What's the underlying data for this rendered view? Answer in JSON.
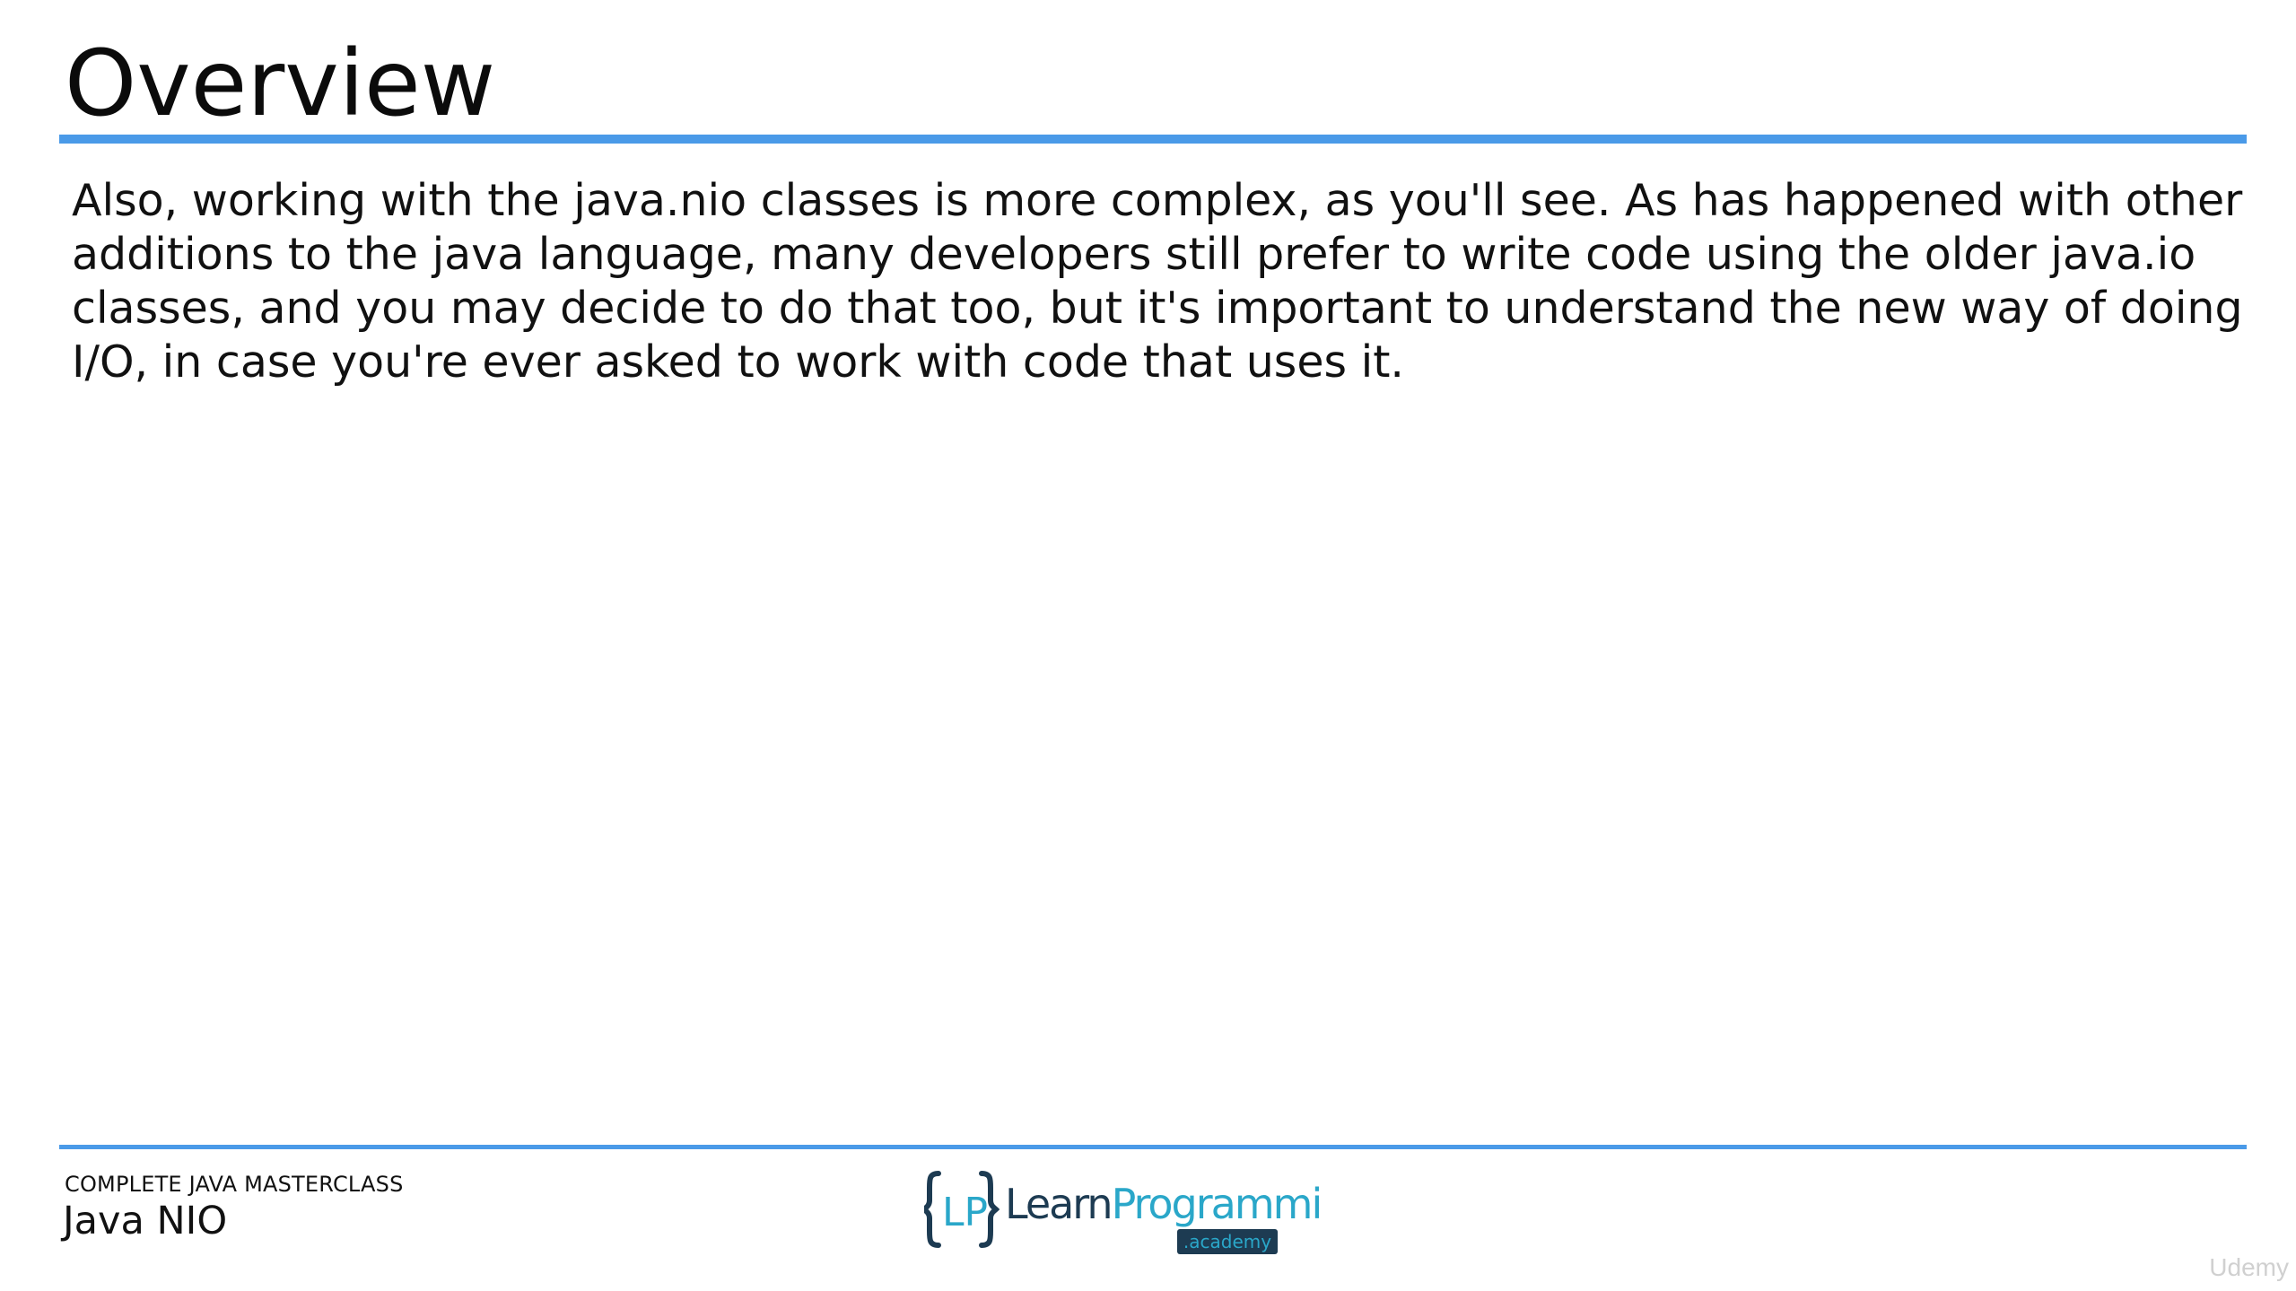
{
  "slide": {
    "title": "Overview",
    "body": "Also, working with the java.nio classes is more complex, as you'll see. As has happened with other additions to the java language, many developers still prefer to write code using the older java.io classes, and you may decide to do that too, but it's important to understand the new way of doing I/O, in case you're ever asked to work with code that uses it."
  },
  "footer": {
    "course": "COMPLETE JAVA MASTERCLASS",
    "topic": "Java NIO",
    "logo": {
      "mark": "LP",
      "learn": "Learn",
      "programming": "Programming",
      "academy": ".academy"
    }
  },
  "watermark": "Udemy",
  "colors": {
    "rule": "#4a9ae8",
    "logo_dark": "#1d3b52",
    "logo_light": "#2aa7c9"
  }
}
